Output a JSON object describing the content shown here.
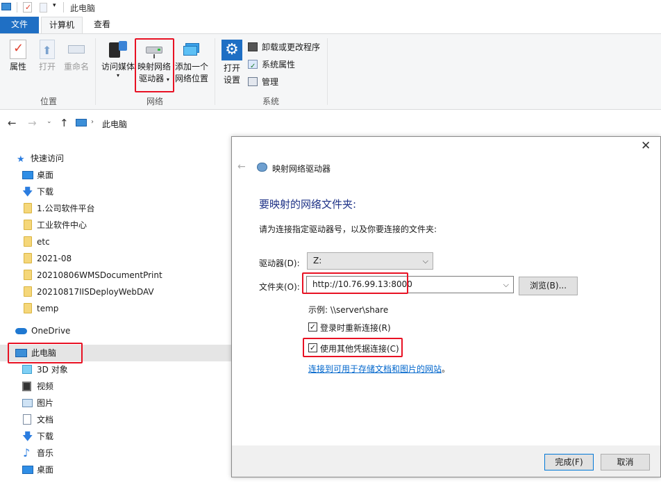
{
  "window": {
    "title": "此电脑"
  },
  "tabs": {
    "file": "文件",
    "computer": "计算机",
    "view": "查看"
  },
  "ribbon": {
    "location": {
      "group_label": "位置",
      "properties": "属性",
      "open": "打开",
      "rename": "重命名"
    },
    "network": {
      "group_label": "网络",
      "access_media": "访问媒体",
      "map_drive_line1": "映射网络",
      "map_drive_line2": "驱动器",
      "add_location_line1": "添加一个",
      "add_location_line2": "网络位置"
    },
    "system": {
      "group_label": "系统",
      "open_settings_line1": "打开",
      "open_settings_line2": "设置",
      "uninstall": "卸载或更改程序",
      "system_props": "系统属性",
      "manage": "管理"
    }
  },
  "address": {
    "path": "此电脑"
  },
  "sidebar": {
    "quick_access": "快速访问",
    "items": [
      "桌面",
      "下载",
      "1.公司软件平台",
      "工业软件中心",
      "etc",
      "2021-08",
      "20210806WMSDocumentPrint",
      "20210817IISDeployWebDAV",
      "temp"
    ],
    "onedrive": "OneDrive",
    "this_pc": "此电脑",
    "pc_items": [
      "3D 对象",
      "视频",
      "图片",
      "文档",
      "下载",
      "音乐",
      "桌面"
    ]
  },
  "dialog": {
    "title": "映射网络驱动器",
    "heading": "要映射的网络文件夹:",
    "instruction": "请为连接指定驱动器号，以及你要连接的文件夹:",
    "drive_label": "驱动器(D):",
    "drive_value": "Z:",
    "folder_label": "文件夹(O):",
    "folder_value": "http://10.76.99.13:8000",
    "browse_label": "浏览(B)...",
    "example": "示例: \\\\server\\share",
    "reconnect_label": "登录时重新连接(R)",
    "reconnect_checked": true,
    "other_creds_label": "使用其他凭据连接(C)",
    "other_creds_checked": true,
    "link_text": "连接到可用于存储文档和图片的网站",
    "link_suffix": "。",
    "finish_label": "完成(F)",
    "cancel_label": "取消"
  },
  "colors": {
    "accent": "#1f6fc4",
    "highlight_red": "#e81123",
    "link": "#0066cc",
    "heading": "#1e3287"
  }
}
